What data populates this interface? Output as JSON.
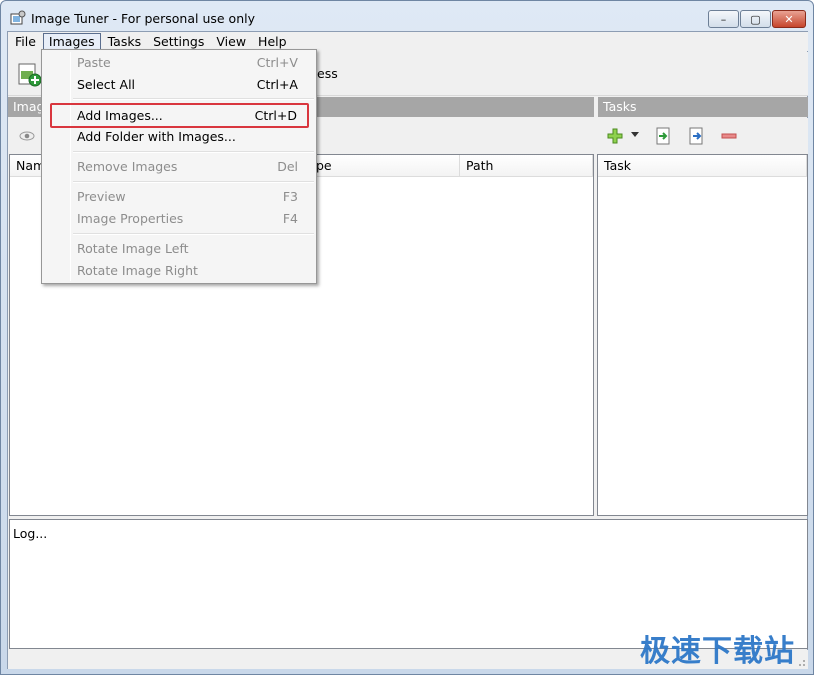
{
  "window": {
    "title": "Image Tuner - For personal use only",
    "controls": {
      "minimize": "–",
      "maximize": "▢",
      "close": "✕"
    }
  },
  "menubar": {
    "items": [
      "File",
      "Images",
      "Tasks",
      "Settings",
      "View",
      "Help"
    ],
    "active": "Images"
  },
  "toolbar": {
    "process_label_tail": "ess"
  },
  "images_panel": {
    "header": "Imag",
    "columns": [
      "Nam",
      "pe",
      "Path"
    ]
  },
  "tasks_panel": {
    "header": "Tasks",
    "columns": [
      "Task"
    ]
  },
  "log": {
    "text": "Log..."
  },
  "dropdown": {
    "items": [
      {
        "label": "Paste",
        "shortcut": "Ctrl+V",
        "enabled": false
      },
      {
        "label": "Select All",
        "shortcut": "Ctrl+A",
        "enabled": true
      },
      {
        "label": "Add Images...",
        "shortcut": "Ctrl+D",
        "enabled": true,
        "highlighted": true
      },
      {
        "label": "Add Folder with Images...",
        "shortcut": "",
        "enabled": true
      },
      {
        "label": "Remove Images",
        "shortcut": "Del",
        "enabled": false
      },
      {
        "label": "Preview",
        "shortcut": "F3",
        "enabled": false
      },
      {
        "label": "Image Properties",
        "shortcut": "F4",
        "enabled": false
      },
      {
        "label": "Rotate Image Left",
        "shortcut": "",
        "enabled": false
      },
      {
        "label": "Rotate Image Right",
        "shortcut": "",
        "enabled": false
      }
    ]
  },
  "watermark": {
    "text": "极速下载站"
  },
  "colors": {
    "highlight_border": "#d9363e",
    "panel_header": "#a6a6a6",
    "watermark": "#2e78c8"
  }
}
